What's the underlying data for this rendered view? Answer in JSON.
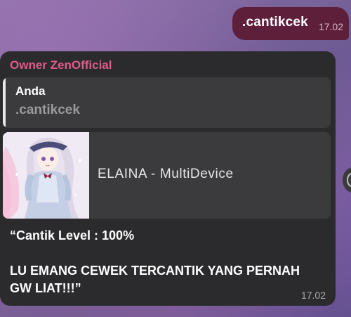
{
  "sent_message": {
    "text": ".cantikcek",
    "time": "17.02"
  },
  "received_message": {
    "sender": "Owner ZenOfficial",
    "quote": {
      "author": "Anda",
      "text": ".cantikcek"
    },
    "link_preview": {
      "title": "ELAINA - MultiDevice",
      "thumbnail_icon": "anime-girl-image"
    },
    "body_lines": [
      "“Cantik Level : 100%",
      "",
      "LU EMANG CEWEK TERCANTIK YANG PERNAH",
      "GW LIAT!!!”"
    ],
    "time": "17.02"
  },
  "colors": {
    "sent_bubble": "#5d1f3a",
    "received_bubble": "#2b2b2d",
    "sender_name": "#e05a8c",
    "quote_background": "#3b3b3d"
  }
}
